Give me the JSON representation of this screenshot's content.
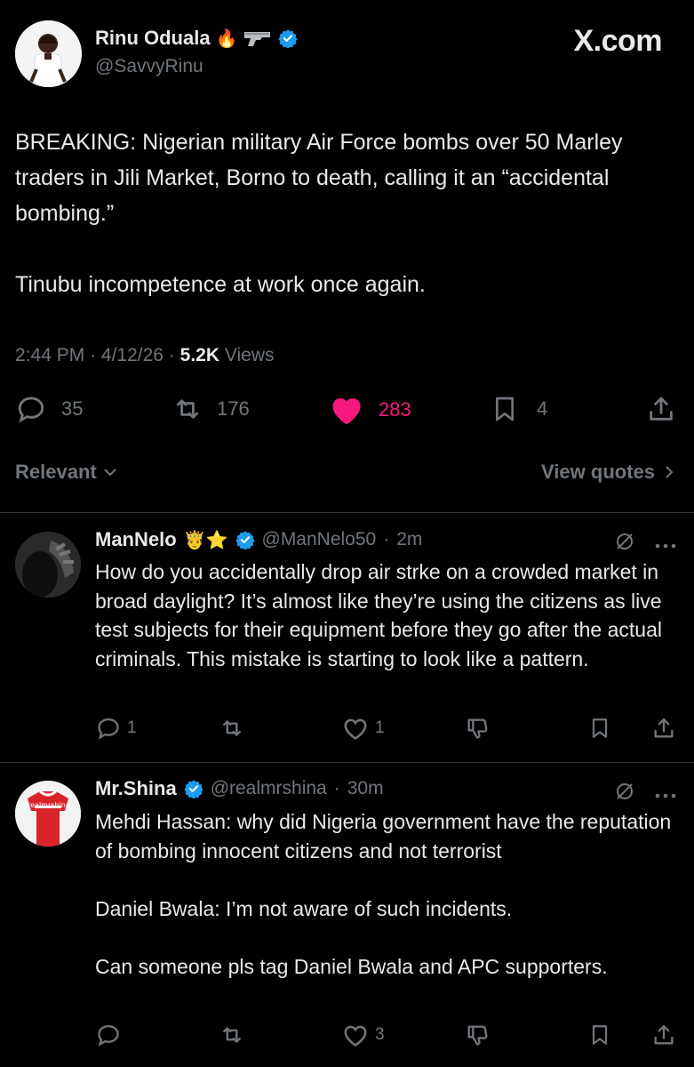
{
  "brand": "X.com",
  "main_tweet": {
    "author_name": "Rinu Oduala",
    "author_emoji": "🔥",
    "author_handle": "@SavvyRinu",
    "text": "BREAKING: Nigerian military Air Force bombs over 50 Marley traders in Jili Market, Borno to death, calling it an “accidental bombing.”\n\nTinubu incompetence at work once again.",
    "time": "2:44 PM",
    "date": "4/12/26",
    "views_count": "5.2K",
    "views_label": "Views",
    "replies": "35",
    "reposts": "176",
    "likes": "283",
    "bookmarks": "4"
  },
  "sort": {
    "label": "Relevant",
    "view_quotes": "View quotes"
  },
  "replies": [
    {
      "name": "ManNelo",
      "emoji": "🤴⭐",
      "handle": "@ManNelo50",
      "time": "2m",
      "text": "How do you accidentally drop air strke on a crowded market in broad daylight? It’s almost like they’re using the citizens as live test subjects for their equipment before they go after the actual criminals. This mistake is starting to look like a pattern.",
      "reply_count": "1",
      "repost_count": "",
      "like_count": "1"
    },
    {
      "name": "Mr.Shina",
      "handle": "@realmrshina",
      "time": "30m",
      "avatar_text": "@realmrshina",
      "text": "Mehdi Hassan: why did Nigeria government have the reputation of bombing innocent citizens and not terrorist\n\nDaniel Bwala: I’m not aware of such incidents.\n\nCan someone pls tag Daniel Bwala and APC supporters.",
      "reply_count": "",
      "repost_count": "",
      "like_count": "3"
    }
  ],
  "colors": {
    "background": "#000000",
    "text": "#e7e9ea",
    "muted": "#71767b",
    "like": "#f91880",
    "verified": "#1d9bf0",
    "divider": "#2f3336"
  }
}
